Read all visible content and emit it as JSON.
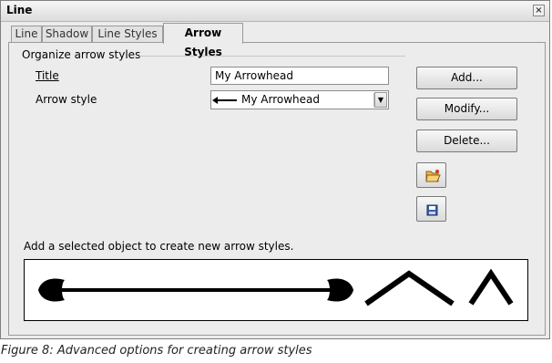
{
  "window": {
    "title": "Line",
    "close_glyph": "×"
  },
  "tabs": [
    {
      "label": "Line",
      "active": false
    },
    {
      "label": "Shadow",
      "active": false
    },
    {
      "label": "Line Styles",
      "active": false
    },
    {
      "label": "Arrow Styles",
      "active": true
    }
  ],
  "organize": {
    "group_label": "Organize arrow styles",
    "title_label": "Title",
    "title_value": "My Arrowhead",
    "arrow_style_label": "Arrow style",
    "arrow_style_value": "My Arrowhead"
  },
  "buttons": {
    "add": "Add...",
    "modify": "Modify...",
    "delete": "Delete...",
    "load_icon": "open-folder-icon",
    "save_icon": "floppy-disk-icon"
  },
  "hint": "Add a selected object to create new arrow styles.",
  "caption": "Figure 8: Advanced options for creating arrow styles"
}
